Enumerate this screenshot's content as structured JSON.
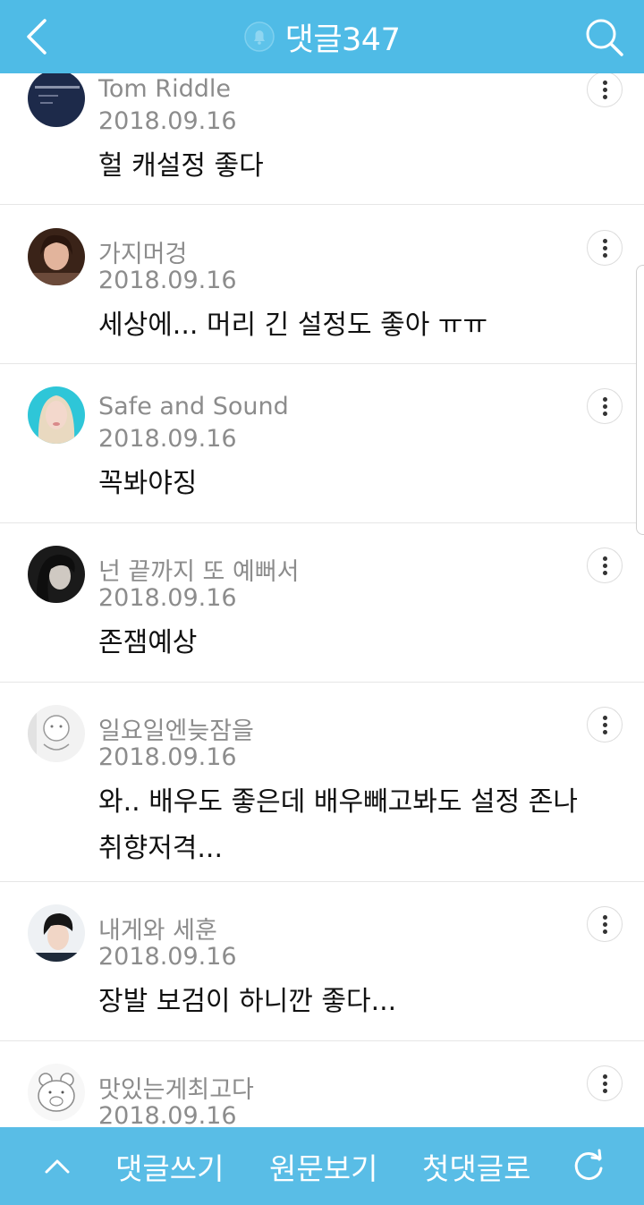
{
  "header": {
    "title": "댓글347",
    "icons": {
      "back": "chevron-left-icon",
      "notification": "bell-icon",
      "search": "search-icon"
    }
  },
  "comments": [
    {
      "author": "Tom Riddle",
      "date": "2018.09.16",
      "text": "헐 캐설정 좋다",
      "avatar": "avatar-dark-text"
    },
    {
      "author": "가지머겅",
      "date": "2018.09.16",
      "text": "세상에... 머리 긴 설정도 좋아 ㅠㅠ",
      "avatar": "avatar-woman-dark-hair"
    },
    {
      "author": "Safe and Sound",
      "date": "2018.09.16",
      "text": "꼭봐야징",
      "avatar": "avatar-blonde-woman"
    },
    {
      "author": "넌 끝까지 또 예뻐서",
      "date": "2018.09.16",
      "text": "존잼예상",
      "avatar": "avatar-woman-black-white"
    },
    {
      "author": "일요일엔늦잠을",
      "date": "2018.09.16",
      "text": "와.. 배우도 좋은데 배우빼고봐도 설정 존나 취향저격...",
      "avatar": "avatar-cartoon-sketch"
    },
    {
      "author": "내게와 세훈",
      "date": "2018.09.16",
      "text": "장발 보검이 하니깐 좋다...",
      "avatar": "avatar-man-short-hair"
    },
    {
      "author": "맛있는게최고다",
      "date": "2018.09.16",
      "text": "",
      "avatar": "avatar-bear-drawing"
    }
  ],
  "bottom_bar": {
    "write_label": "댓글쓰기",
    "original_label": "원문보기",
    "first_label": "첫댓글로",
    "icons": {
      "up": "chevron-up-icon",
      "refresh": "refresh-icon"
    }
  },
  "colors": {
    "header": "#4fbbe6",
    "bottom_bar": "#59bde6",
    "meta_text": "#8c8c8c",
    "body_text": "#111111"
  }
}
